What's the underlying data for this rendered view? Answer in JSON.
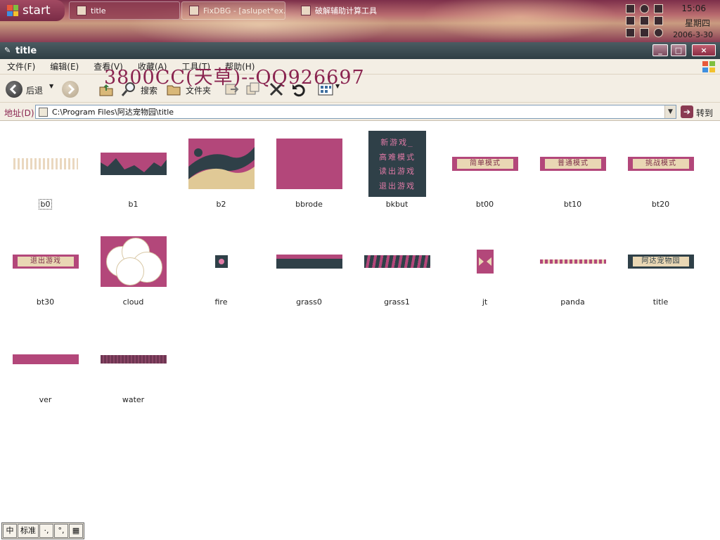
{
  "taskbar": {
    "start_label": "start",
    "tasks": [
      {
        "label": "title",
        "state": "active"
      },
      {
        "label": "FixDBG - [aslupet*ex...",
        "state": "inactive"
      },
      {
        "label": "破解辅助计算工具",
        "state": "plain"
      }
    ],
    "clock": {
      "time": "15:06",
      "day": "星期四",
      "date": "2006-3-30"
    }
  },
  "window": {
    "title": "title",
    "controls": {
      "minimize": "_",
      "maximize": "□",
      "close": "×"
    }
  },
  "menu": {
    "items": [
      "文件(F)",
      "编辑(E)",
      "查看(V)",
      "收藏(A)",
      "工具(T)",
      "帮助(H)"
    ]
  },
  "watermark": "3800CC(天草)--QQ926697",
  "toolbar": {
    "back_label": "后退",
    "search_label": "搜索",
    "folders_label": "文件夹"
  },
  "address": {
    "label": "地址(D)",
    "path": "C:\\Program Files\\阿达宠物园\\title",
    "go_label": "转到"
  },
  "files": [
    {
      "name": "b0",
      "selected": true
    },
    {
      "name": "b1"
    },
    {
      "name": "b2"
    },
    {
      "name": "bbrode"
    },
    {
      "name": "bkbut",
      "thumb_lines": [
        "新游戏_",
        "高难模式",
        "读出游戏",
        "退出游戏"
      ]
    },
    {
      "name": "bt00",
      "thumb_text": "简单模式"
    },
    {
      "name": "bt10",
      "thumb_text": "普通模式"
    },
    {
      "name": "bt20",
      "thumb_text": "挑战模式"
    },
    {
      "name": "bt30",
      "thumb_text": "退出游戏"
    },
    {
      "name": "cloud"
    },
    {
      "name": "fire"
    },
    {
      "name": "grass0"
    },
    {
      "name": "grass1"
    },
    {
      "name": "jt"
    },
    {
      "name": "panda"
    },
    {
      "name": "title",
      "thumb_text": "阿达宠物园"
    },
    {
      "name": "ver"
    },
    {
      "name": "water"
    }
  ],
  "ime": {
    "buttons": [
      "中",
      "标准",
      "·,",
      "°,",
      "▦"
    ]
  },
  "colors": {
    "accent": "#b3477a",
    "dark": "#2f4048",
    "cream": "#e9d7b4",
    "titlebar": "#3d4d53",
    "watermark": "#8a2450"
  }
}
